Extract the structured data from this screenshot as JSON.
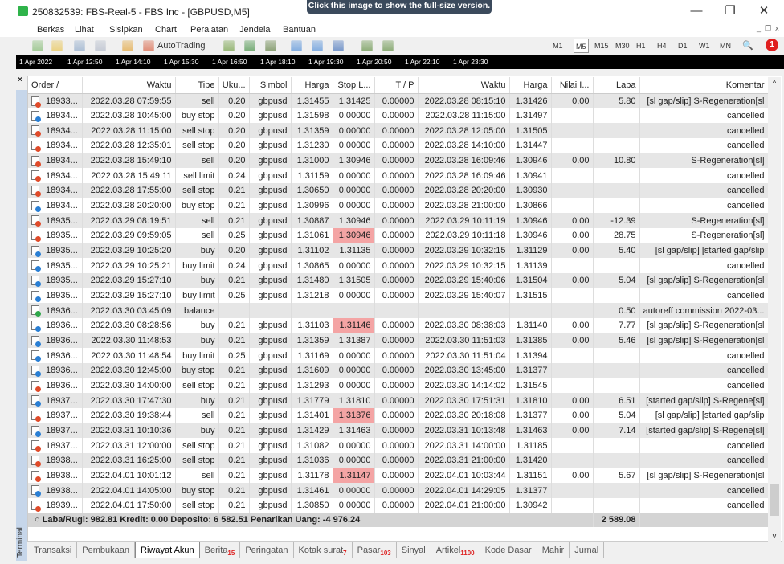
{
  "window": {
    "title": "250832539: FBS-Real-5 - FBS Inc - [GBPUSD,M5]",
    "tooltip": "Click this image to show the full-size version.",
    "minimize": "—",
    "restore": "❐",
    "close": "✕"
  },
  "menu": [
    "Berkas",
    "Lihat",
    "Sisipkan",
    "Chart",
    "Peralatan",
    "Jendela",
    "Bantuan"
  ],
  "mdi": {
    "min": "_",
    "restore": "❐",
    "close": "x"
  },
  "toolbar": {
    "autotrading": "AutoTrading",
    "timeframes": [
      "M1",
      "M5",
      "M15",
      "M30",
      "H1",
      "H4",
      "D1",
      "W1",
      "MN"
    ],
    "active_timeframe": "M5",
    "notification_count": "1"
  },
  "timeline": [
    "1 Apr 2022",
    "1 Apr 12:50",
    "1 Apr 14:10",
    "1 Apr 15:30",
    "1 Apr 16:50",
    "1 Apr 18:10",
    "1 Apr 19:30",
    "1 Apr 20:50",
    "1 Apr 22:10",
    "1 Apr 23:30"
  ],
  "terminal": {
    "label": "Terminal",
    "close": "×"
  },
  "columns": [
    "Order  /",
    "Waktu",
    "Tipe",
    "Uku...",
    "Simbol",
    "Harga",
    "Stop L...",
    "T / P",
    "Waktu",
    "Harga",
    "Nilai I...",
    "Laba",
    "Komentar"
  ],
  "rows": [
    [
      "18933...",
      "2022.03.28 07:59:55",
      "sell",
      "0.20",
      "gbpusd",
      "1.31455",
      "1.31425",
      "0.00000",
      "2022.03.28 08:15:10",
      "1.31426",
      "0.00",
      "5.80",
      "[sl gap/slip] S-Regeneration[sl"
    ],
    [
      "18934...",
      "2022.03.28 10:45:00",
      "buy stop",
      "0.20",
      "gbpusd",
      "1.31598",
      "0.00000",
      "0.00000",
      "2022.03.28 11:15:00",
      "1.31497",
      "",
      "",
      "cancelled"
    ],
    [
      "18934...",
      "2022.03.28 11:15:00",
      "sell stop",
      "0.20",
      "gbpusd",
      "1.31359",
      "0.00000",
      "0.00000",
      "2022.03.28 12:05:00",
      "1.31505",
      "",
      "",
      "cancelled"
    ],
    [
      "18934...",
      "2022.03.28 12:35:01",
      "sell stop",
      "0.20",
      "gbpusd",
      "1.31230",
      "0.00000",
      "0.00000",
      "2022.03.28 14:10:00",
      "1.31447",
      "",
      "",
      "cancelled"
    ],
    [
      "18934...",
      "2022.03.28 15:49:10",
      "sell",
      "0.20",
      "gbpusd",
      "1.31000",
      "1.30946",
      "0.00000",
      "2022.03.28 16:09:46",
      "1.30946",
      "0.00",
      "10.80",
      "S-Regeneration[sl]"
    ],
    [
      "18934...",
      "2022.03.28 15:49:11",
      "sell limit",
      "0.24",
      "gbpusd",
      "1.31159",
      "0.00000",
      "0.00000",
      "2022.03.28 16:09:46",
      "1.30941",
      "",
      "",
      "cancelled"
    ],
    [
      "18934...",
      "2022.03.28 17:55:00",
      "sell stop",
      "0.21",
      "gbpusd",
      "1.30650",
      "0.00000",
      "0.00000",
      "2022.03.28 20:20:00",
      "1.30930",
      "",
      "",
      "cancelled"
    ],
    [
      "18934...",
      "2022.03.28 20:20:00",
      "buy stop",
      "0.21",
      "gbpusd",
      "1.30996",
      "0.00000",
      "0.00000",
      "2022.03.28 21:00:00",
      "1.30866",
      "",
      "",
      "cancelled"
    ],
    [
      "18935...",
      "2022.03.29 08:19:51",
      "sell",
      "0.21",
      "gbpusd",
      "1.30887",
      "1.30946",
      "0.00000",
      "2022.03.29 10:11:19",
      "1.30946",
      "0.00",
      "-12.39",
      "S-Regeneration[sl]"
    ],
    [
      "18935...",
      "2022.03.29 09:59:05",
      "sell",
      "0.25",
      "gbpusd",
      "1.31061",
      "1.30946",
      "0.00000",
      "2022.03.29 10:11:18",
      "1.30946",
      "0.00",
      "28.75",
      "S-Regeneration[sl]"
    ],
    [
      "18935...",
      "2022.03.29 10:25:20",
      "buy",
      "0.20",
      "gbpusd",
      "1.31102",
      "1.31135",
      "0.00000",
      "2022.03.29 10:32:15",
      "1.31129",
      "0.00",
      "5.40",
      "[sl gap/slip] [started gap/slip"
    ],
    [
      "18935...",
      "2022.03.29 10:25:21",
      "buy limit",
      "0.24",
      "gbpusd",
      "1.30865",
      "0.00000",
      "0.00000",
      "2022.03.29 10:32:15",
      "1.31139",
      "",
      "",
      "cancelled"
    ],
    [
      "18935...",
      "2022.03.29 15:27:10",
      "buy",
      "0.21",
      "gbpusd",
      "1.31480",
      "1.31505",
      "0.00000",
      "2022.03.29 15:40:06",
      "1.31504",
      "0.00",
      "5.04",
      "[sl gap/slip] S-Regeneration[sl"
    ],
    [
      "18935...",
      "2022.03.29 15:27:10",
      "buy limit",
      "0.25",
      "gbpusd",
      "1.31218",
      "0.00000",
      "0.00000",
      "2022.03.29 15:40:07",
      "1.31515",
      "",
      "",
      "cancelled"
    ],
    [
      "18936...",
      "2022.03.30 03:45:09",
      "balance",
      "",
      "",
      "",
      "",
      "",
      "",
      "",
      "",
      "0.50",
      "autoreff commission 2022-03..."
    ],
    [
      "18936...",
      "2022.03.30 08:28:56",
      "buy",
      "0.21",
      "gbpusd",
      "1.31103",
      "1.31146",
      "0.00000",
      "2022.03.30 08:38:03",
      "1.31140",
      "0.00",
      "7.77",
      "[sl gap/slip] S-Regeneration[sl"
    ],
    [
      "18936...",
      "2022.03.30 11:48:53",
      "buy",
      "0.21",
      "gbpusd",
      "1.31359",
      "1.31387",
      "0.00000",
      "2022.03.30 11:51:03",
      "1.31385",
      "0.00",
      "5.46",
      "[sl gap/slip] S-Regeneration[sl"
    ],
    [
      "18936...",
      "2022.03.30 11:48:54",
      "buy limit",
      "0.25",
      "gbpusd",
      "1.31169",
      "0.00000",
      "0.00000",
      "2022.03.30 11:51:04",
      "1.31394",
      "",
      "",
      "cancelled"
    ],
    [
      "18936...",
      "2022.03.30 12:45:00",
      "buy stop",
      "0.21",
      "gbpusd",
      "1.31609",
      "0.00000",
      "0.00000",
      "2022.03.30 13:45:00",
      "1.31377",
      "",
      "",
      "cancelled"
    ],
    [
      "18936...",
      "2022.03.30 14:00:00",
      "sell stop",
      "0.21",
      "gbpusd",
      "1.31293",
      "0.00000",
      "0.00000",
      "2022.03.30 14:14:02",
      "1.31545",
      "",
      "",
      "cancelled"
    ],
    [
      "18937...",
      "2022.03.30 17:47:30",
      "buy",
      "0.21",
      "gbpusd",
      "1.31779",
      "1.31810",
      "0.00000",
      "2022.03.30 17:51:31",
      "1.31810",
      "0.00",
      "6.51",
      "[started gap/slip] S-Regene[sl]"
    ],
    [
      "18937...",
      "2022.03.30 19:38:44",
      "sell",
      "0.21",
      "gbpusd",
      "1.31401",
      "1.31376",
      "0.00000",
      "2022.03.30 20:18:08",
      "1.31377",
      "0.00",
      "5.04",
      "[sl gap/slip] [started gap/slip"
    ],
    [
      "18937...",
      "2022.03.31 10:10:36",
      "buy",
      "0.21",
      "gbpusd",
      "1.31429",
      "1.31463",
      "0.00000",
      "2022.03.31 10:13:48",
      "1.31463",
      "0.00",
      "7.14",
      "[started gap/slip] S-Regene[sl]"
    ],
    [
      "18937...",
      "2022.03.31 12:00:00",
      "sell stop",
      "0.21",
      "gbpusd",
      "1.31082",
      "0.00000",
      "0.00000",
      "2022.03.31 14:00:00",
      "1.31185",
      "",
      "",
      "cancelled"
    ],
    [
      "18938...",
      "2022.03.31 16:25:00",
      "sell stop",
      "0.21",
      "gbpusd",
      "1.31036",
      "0.00000",
      "0.00000",
      "2022.03.31 21:00:00",
      "1.31420",
      "",
      "",
      "cancelled"
    ],
    [
      "18938...",
      "2022.04.01 10:01:12",
      "sell",
      "0.21",
      "gbpusd",
      "1.31178",
      "1.31147",
      "0.00000",
      "2022.04.01 10:03:44",
      "1.31151",
      "0.00",
      "5.67",
      "[sl gap/slip] S-Regeneration[sl"
    ],
    [
      "18938...",
      "2022.04.01 14:05:00",
      "buy stop",
      "0.21",
      "gbpusd",
      "1.31461",
      "0.00000",
      "0.00000",
      "2022.04.01 14:29:05",
      "1.31377",
      "",
      "",
      "cancelled"
    ],
    [
      "18939...",
      "2022.04.01 17:50:00",
      "sell stop",
      "0.21",
      "gbpusd",
      "1.30850",
      "0.00000",
      "0.00000",
      "2022.04.01 21:00:00",
      "1.30942",
      "",
      "",
      "cancelled"
    ]
  ],
  "summary": {
    "text": "Laba/Rugi: 982.81  Kredit: 0.00  Deposito: 6 582.51  Penarikan Uang: -4 976.24",
    "total": "2 589.08"
  },
  "tabs": [
    {
      "label": "Transaksi"
    },
    {
      "label": "Pembukaan"
    },
    {
      "label": "Riwayat Akun",
      "active": true
    },
    {
      "label": "Berita",
      "badge": "15"
    },
    {
      "label": "Peringatan"
    },
    {
      "label": "Kotak surat",
      "badge": "7"
    },
    {
      "label": "Pasar",
      "badge": "103"
    },
    {
      "label": "Sinyal"
    },
    {
      "label": "Artikel",
      "badge": "1100"
    },
    {
      "label": "Kode Dasar"
    },
    {
      "label": "Mahir"
    },
    {
      "label": "Jurnal"
    }
  ],
  "colors": {
    "sl_highlight": "#f4a4a4",
    "sell_icon": "#e04b2a",
    "buy_icon": "#2a7fd4",
    "balance_icon": "#2fa84a",
    "badge": "#dd2222"
  }
}
